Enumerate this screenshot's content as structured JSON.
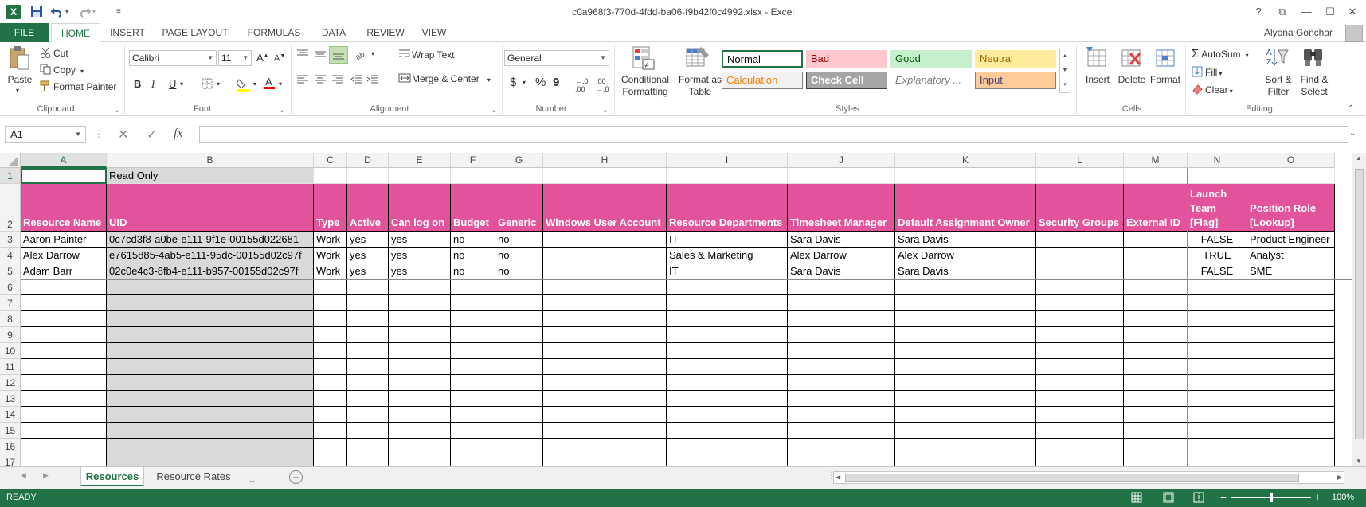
{
  "window": {
    "title": "c0a968f3-770d-4fdd-ba06-f9b42f0c4992.xlsx - Excel",
    "help": "?",
    "restore_ribbon": "⧉",
    "minimize": "—",
    "maximize": "☐",
    "close": "✕"
  },
  "ribbon_tabs": [
    "FILE",
    "HOME",
    "INSERT",
    "PAGE LAYOUT",
    "FORMULAS",
    "DATA",
    "REVIEW",
    "VIEW"
  ],
  "user": "Alyona Gonchar",
  "clipboard": {
    "paste": "Paste",
    "cut": "Cut",
    "copy": "Copy",
    "format_painter": "Format Painter",
    "label": "Clipboard"
  },
  "font": {
    "name": "Calibri",
    "size": "11",
    "label": "Font"
  },
  "alignment": {
    "wrap_text": "Wrap Text",
    "merge_center": "Merge & Center",
    "label": "Alignment"
  },
  "number": {
    "format": "General",
    "label": "Number"
  },
  "styles": {
    "conditional_formatting": "Conditional Formatting",
    "format_as_table": "Format as Table",
    "cells": [
      {
        "label": "Normal",
        "bg": "#ffffff",
        "fg": "#000000",
        "border": "#217346"
      },
      {
        "label": "Bad",
        "bg": "#ffc7ce",
        "fg": "#9c0006",
        "border": "#ffc7ce"
      },
      {
        "label": "Good",
        "bg": "#c6efce",
        "fg": "#006100",
        "border": "#c6efce"
      },
      {
        "label": "Neutral",
        "bg": "#ffeb9c",
        "fg": "#9c6500",
        "border": "#ffeb9c"
      },
      {
        "label": "Calculation",
        "bg": "#f2f2f2",
        "fg": "#fa7d00",
        "border": "#7f7f7f"
      },
      {
        "label": "Check Cell",
        "bg": "#a5a5a5",
        "fg": "#ffffff",
        "border": "#3f3f3f"
      },
      {
        "label": "Explanatory ...",
        "bg": "#ffffff",
        "fg": "#7f7f7f",
        "border": "#ffffff"
      },
      {
        "label": "Input",
        "bg": "#ffcc99",
        "fg": "#3f3f76",
        "border": "#7f7f7f"
      }
    ],
    "label": "Styles"
  },
  "cells_group": {
    "insert": "Insert",
    "delete": "Delete",
    "format": "Format",
    "label": "Cells"
  },
  "editing": {
    "autosum": "AutoSum",
    "fill": "Fill",
    "clear": "Clear",
    "sort_filter": "Sort & Filter",
    "find_select": "Find & Select",
    "label": "Editing"
  },
  "formula_bar": {
    "name_box": "A1",
    "cancel": "✕",
    "enter": "✓",
    "fx": "fx",
    "value": ""
  },
  "sheet": {
    "columns": [
      "A",
      "B",
      "C",
      "D",
      "E",
      "F",
      "G",
      "H",
      "I",
      "J",
      "K",
      "L",
      "M",
      "N",
      "O"
    ],
    "row_numbers": [
      "1",
      "2",
      "3",
      "4",
      "5",
      "6",
      "7",
      "8",
      "9",
      "10",
      "11",
      "12",
      "13",
      "14",
      "15",
      "16",
      "17"
    ],
    "row1_b": "Read Only",
    "headers": [
      "Resource Name",
      "UID",
      "Type",
      "Active",
      "Can log on",
      "Budget",
      "Generic",
      "Windows User Account",
      "Resource Departments",
      "Timesheet Manager",
      "Default Assignment Owner",
      "Security Groups",
      "External ID",
      "Launch Team [Flag]",
      "Position Role [Lookup]"
    ],
    "rows": [
      [
        "Aaron Painter",
        "0c7cd3f8-a0be-e111-9f1e-00155d022681",
        "Work",
        "yes",
        "yes",
        "no",
        "no",
        "",
        "IT",
        "Sara Davis",
        "Sara Davis",
        "",
        "",
        "FALSE",
        "Product Engineer"
      ],
      [
        "Alex Darrow",
        "e7615885-4ab5-e111-95dc-00155d02c97f",
        "Work",
        "yes",
        "yes",
        "no",
        "no",
        "",
        "Sales & Marketing",
        "Alex Darrow",
        "Alex Darrow",
        "",
        "",
        "TRUE",
        "Analyst"
      ],
      [
        "Adam Barr",
        "02c0e4c3-8fb4-e111-b957-00155d02c97f",
        "Work",
        "yes",
        "yes",
        "no",
        "no",
        "",
        "IT",
        "Sara Davis",
        "Sara Davis",
        "",
        "",
        "FALSE",
        "SME"
      ]
    ],
    "header_color": "#e2539b"
  },
  "sheet_tabs": [
    "Resources",
    "Resource Rates",
    "_"
  ],
  "add_sheet": "+",
  "status": {
    "ready": "READY",
    "zoom": "100%"
  }
}
